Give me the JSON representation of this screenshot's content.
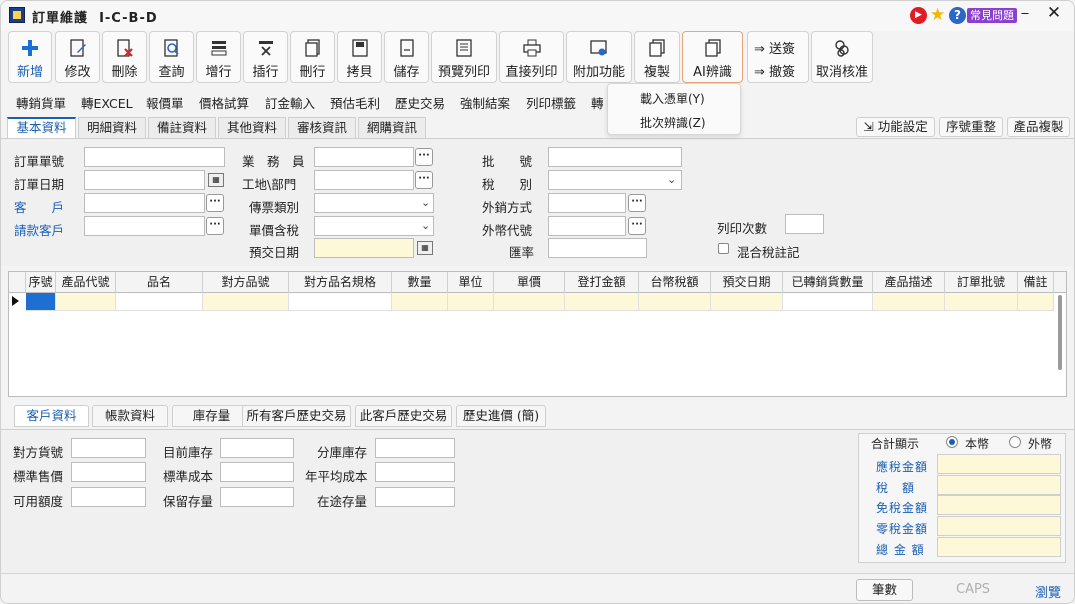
{
  "window": {
    "title": "訂單維護",
    "code": "I-C-B-D",
    "faq_label": "常見問題"
  },
  "toolbar": {
    "buttons": [
      {
        "label": "新增",
        "icon": "plus-icon"
      },
      {
        "label": "修改",
        "icon": "edit-icon"
      },
      {
        "label": "刪除",
        "icon": "delete-icon"
      },
      {
        "label": "查詢",
        "icon": "search-icon"
      },
      {
        "label": "增行",
        "icon": "add-row-icon"
      },
      {
        "label": "插行",
        "icon": "insert-row-icon"
      },
      {
        "label": "刪行",
        "icon": "delete-row-icon"
      },
      {
        "label": "拷貝",
        "icon": "copy-icon"
      },
      {
        "label": "儲存",
        "icon": "save-icon"
      },
      {
        "label": "預覽列印",
        "icon": "print-preview-icon"
      },
      {
        "label": "直接列印",
        "icon": "printer-icon"
      },
      {
        "label": "附加功能",
        "icon": "extra-function-icon"
      },
      {
        "label": "複製",
        "icon": "duplicate-icon"
      },
      {
        "label": "AI辨識",
        "icon": "ai-recognize-icon"
      }
    ],
    "sign_send": "送簽",
    "sign_withdraw": "撤簽",
    "cancel_approve": "取消核准"
  },
  "func_tabs": [
    "轉銷貨單",
    "轉EXCEL",
    "報價單",
    "價格試算",
    "訂金輸入",
    "預估毛利",
    "歷史交易",
    "強制結案",
    "列印標籤",
    "轉"
  ],
  "dropdown": {
    "items": [
      "載入憑單(Y)",
      "批次辨識(Z)"
    ]
  },
  "tabs": [
    "基本資料",
    "明細資料",
    "備註資料",
    "其他資料",
    "審核資訊",
    "網購資訊"
  ],
  "right_buttons": [
    "功能設定",
    "序號重整",
    "產品複製"
  ],
  "form": {
    "order_no": "訂單單號",
    "order_date": "訂單日期",
    "customer": "客　　戶",
    "bill_customer": "請款客戶",
    "salesman": "業　務　員",
    "site_dept": "工地\\部門",
    "voucher_type": "傳票類別",
    "price_tax": "單價含稅",
    "delivery_date": "預交日期",
    "batch_no": "批　　號",
    "tax_type": "稅　　別",
    "export_method": "外銷方式",
    "currency_code": "外幣代號",
    "exchange_rate": "匯率",
    "print_count": "列印次數",
    "mixed_tax": "混合稅註記"
  },
  "grid": {
    "columns": [
      "序號",
      "產品代號",
      "品名",
      "對方品號",
      "對方品名規格",
      "數量",
      "單位",
      "單價",
      "登打金額",
      "台幣稅額",
      "預交日期",
      "已轉銷貨數量",
      "產品描述",
      "訂單批號",
      "備註"
    ]
  },
  "bottom_tabs": [
    "客戶資料",
    "帳款資料",
    "庫存量",
    "所有客戶歷史交易",
    "此客戶歷史交易",
    "歷史進價 (簡)"
  ],
  "bottom_form": {
    "col1": [
      "對方貨號",
      "標準售價",
      "可用額度"
    ],
    "col2": [
      "目前庫存",
      "標準成本",
      "保留存量"
    ],
    "col3": [
      "分庫庫存",
      "年平均成本",
      "在途存量"
    ]
  },
  "totals": {
    "title": "合計顯示",
    "radio_local": "本幣",
    "radio_foreign": "外幣",
    "rows": [
      "應稅金額",
      "稅　額",
      "免稅金額",
      "零稅金額",
      "總 金 額"
    ]
  },
  "status": {
    "count_button": "筆數",
    "caps": "CAPS",
    "browse": "瀏覽"
  }
}
